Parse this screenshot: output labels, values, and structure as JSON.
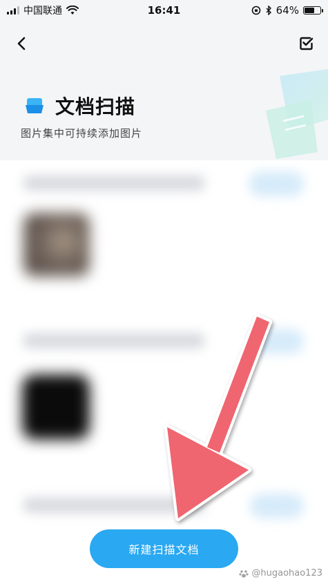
{
  "status_bar": {
    "carrier": "中国联通",
    "time": "16:41",
    "battery_text": "64%",
    "battery_level": 0.64
  },
  "nav": {
    "back_icon": "chevron-left-icon",
    "select_icon": "checkbox-icon"
  },
  "header": {
    "title": "文档扫描",
    "subtitle": "图片集中可持续添加图片",
    "accent_color": "#2aa8f2"
  },
  "actions": {
    "new_scan_label": "新建扫描文档"
  },
  "watermark": {
    "text": "@hugaohao123"
  },
  "colors": {
    "arrow": "#ef6570",
    "button": "#2aa8f2",
    "background": "#f4f5f7"
  }
}
